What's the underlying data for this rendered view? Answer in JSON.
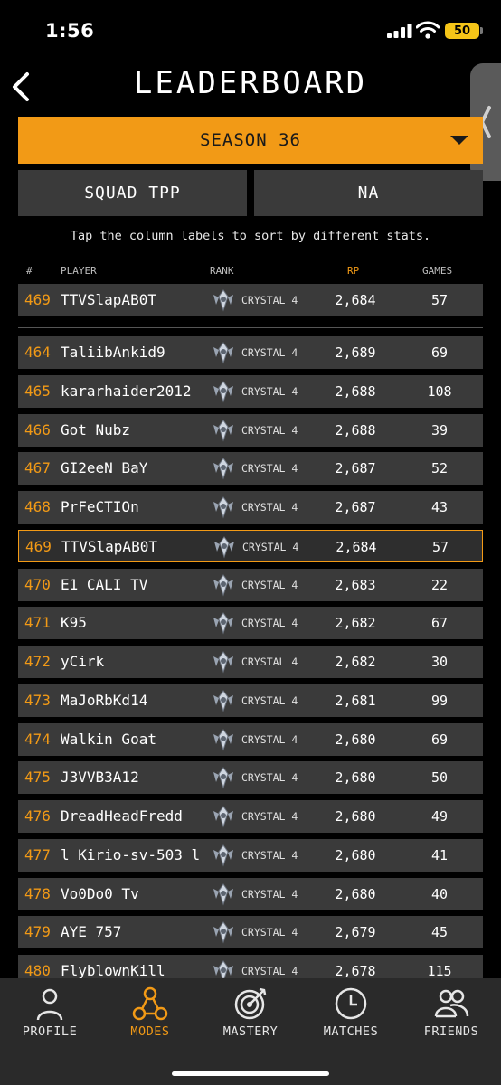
{
  "status_bar": {
    "time": "1:56",
    "battery": "50"
  },
  "header": {
    "title": "LEADERBOARD"
  },
  "season": {
    "label": "SEASON 36"
  },
  "filters": {
    "mode": "SQUAD TPP",
    "region": "NA"
  },
  "hint": "Tap the column labels to sort by different stats.",
  "columns": {
    "num": "#",
    "player": "PLAYER",
    "rank": "RANK",
    "rp": "RP",
    "games": "GAMES"
  },
  "my_row": {
    "num": "469",
    "player": "TTVSlapAB0T",
    "rank": "CRYSTAL 4",
    "rp": "2,684",
    "games": "57"
  },
  "rows": [
    {
      "num": "464",
      "player": "TaliibAnkid9",
      "rank": "CRYSTAL 4",
      "rp": "2,689",
      "games": "69"
    },
    {
      "num": "465",
      "player": "kararhaider2012",
      "rank": "CRYSTAL 4",
      "rp": "2,688",
      "games": "108"
    },
    {
      "num": "466",
      "player": "Got Nubz",
      "rank": "CRYSTAL 4",
      "rp": "2,688",
      "games": "39"
    },
    {
      "num": "467",
      "player": "GI2eeN BaY",
      "rank": "CRYSTAL 4",
      "rp": "2,687",
      "games": "52"
    },
    {
      "num": "468",
      "player": "PrFeCTIOn",
      "rank": "CRYSTAL 4",
      "rp": "2,687",
      "games": "43"
    },
    {
      "num": "469",
      "player": "TTVSlapAB0T",
      "rank": "CRYSTAL 4",
      "rp": "2,684",
      "games": "57"
    },
    {
      "num": "470",
      "player": "E1 CALI TV",
      "rank": "CRYSTAL 4",
      "rp": "2,683",
      "games": "22"
    },
    {
      "num": "471",
      "player": "K95",
      "rank": "CRYSTAL 4",
      "rp": "2,682",
      "games": "67"
    },
    {
      "num": "472",
      "player": "yCirk",
      "rank": "CRYSTAL 4",
      "rp": "2,682",
      "games": "30"
    },
    {
      "num": "473",
      "player": "MaJoRbKd14",
      "rank": "CRYSTAL 4",
      "rp": "2,681",
      "games": "99"
    },
    {
      "num": "474",
      "player": "Walkin Goat",
      "rank": "CRYSTAL 4",
      "rp": "2,680",
      "games": "69"
    },
    {
      "num": "475",
      "player": "J3VVB3A12",
      "rank": "CRYSTAL 4",
      "rp": "2,680",
      "games": "50"
    },
    {
      "num": "476",
      "player": "DreadHeadFredd",
      "rank": "CRYSTAL 4",
      "rp": "2,680",
      "games": "49"
    },
    {
      "num": "477",
      "player": "l_Kirio-sv-503_l",
      "rank": "CRYSTAL 4",
      "rp": "2,680",
      "games": "41"
    },
    {
      "num": "478",
      "player": "Vo0Do0 Tv",
      "rank": "CRYSTAL 4",
      "rp": "2,680",
      "games": "40"
    },
    {
      "num": "479",
      "player": "AYE 757",
      "rank": "CRYSTAL 4",
      "rp": "2,679",
      "games": "45"
    },
    {
      "num": "480",
      "player": "FlyblownKill",
      "rank": "CRYSTAL 4",
      "rp": "2,678",
      "games": "115"
    }
  ],
  "highlight_index": 5,
  "tabs": [
    {
      "label": "PROFILE",
      "icon": "person-icon"
    },
    {
      "label": "MODES",
      "icon": "modes-icon",
      "active": true
    },
    {
      "label": "MASTERY",
      "icon": "target-icon"
    },
    {
      "label": "MATCHES",
      "icon": "clock-icon"
    },
    {
      "label": "FRIENDS",
      "icon": "friends-icon"
    }
  ],
  "colors": {
    "accent": "#f29a16",
    "row_bg": "#3a3a3a",
    "tabbar_bg": "#2a2a2a"
  }
}
